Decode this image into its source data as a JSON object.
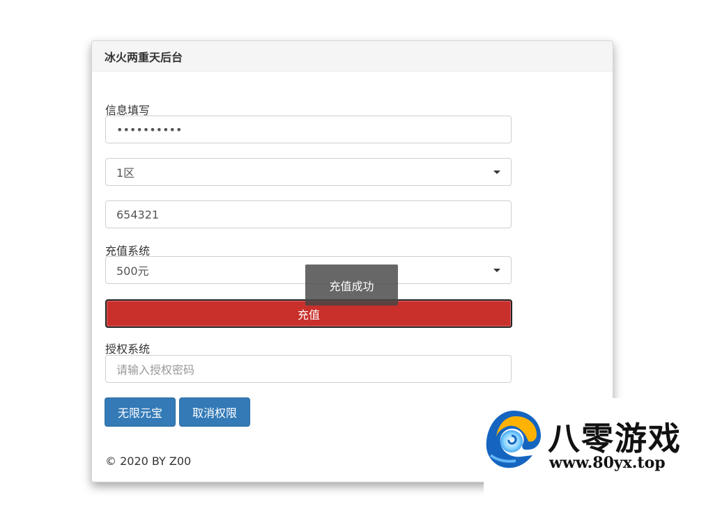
{
  "panel": {
    "title": "冰火两重天后台"
  },
  "info_section": {
    "label": "信息填写",
    "password_value": "••••••••••",
    "server_select_value": "1区",
    "role_id_value": "654321"
  },
  "recharge_section": {
    "label": "充值系统",
    "amount_select_value": "500元",
    "recharge_button": "充值"
  },
  "auth_section": {
    "label": "授权系统",
    "auth_code_placeholder": "请输入授权密码",
    "unlimited_yuanbao_button": "无限元宝",
    "revoke_button": "取消权限"
  },
  "footer": {
    "copyright": "© 2020 BY Z00"
  },
  "toast": {
    "message": "充值成功"
  },
  "watermark": {
    "brand": "八零游戏",
    "url": "www.80yx.top"
  },
  "colors": {
    "danger": "#c9302c",
    "primary": "#337ab7",
    "heading_bg": "#f5f5f5"
  }
}
